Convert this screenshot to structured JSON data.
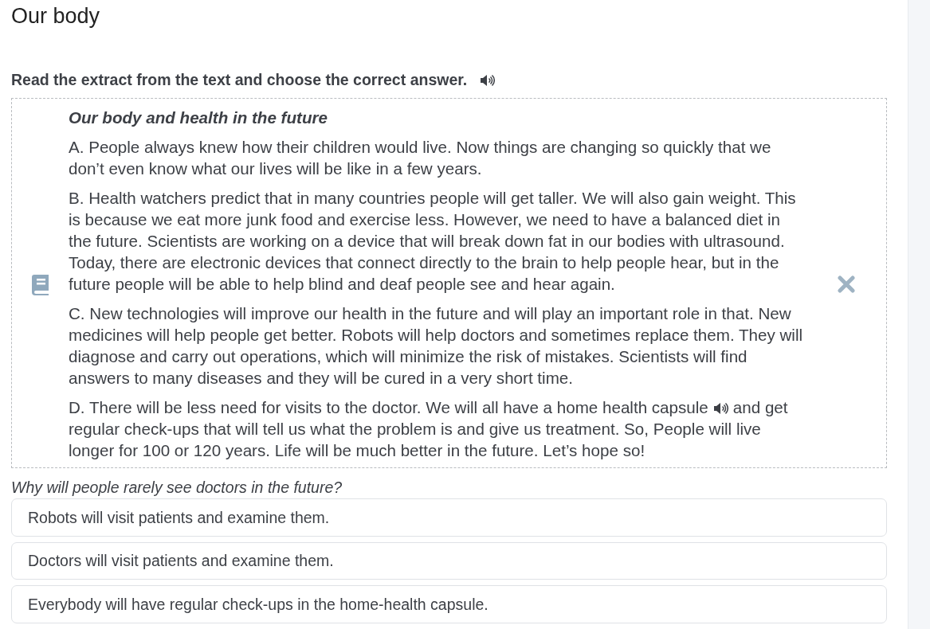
{
  "page_title": "Our body",
  "instruction": {
    "text": "Read the extract from the text and choose the correct answer.",
    "audio": true
  },
  "passage": {
    "title": "Our body and health in the future",
    "paragraphs": [
      {
        "segments": [
          {
            "kind": "text",
            "text": "A. People always knew how their children would live. Now things are changing so quickly that we don’t even know what our lives will be like in a few years."
          }
        ]
      },
      {
        "segments": [
          {
            "kind": "text",
            "text": "B. Health watchers predict that in many countries people will get taller. We will also gain weight. This is because we eat more junk food and exercise less. However, we need to have a balanced diet in the future. Scientists are working on a device that will break down fat in our bodies with ultrasound. Today, there are electronic devices that connect directly to the brain to help people hear, but in the future people will be able to help blind and deaf people see and hear again."
          }
        ]
      },
      {
        "segments": [
          {
            "kind": "text",
            "text": "C. New technologies will improve our health in the future and will play an important role in that. New medicines will help people get better. Robots will help doctors and sometimes replace them. They will diagnose and carry out operations, which will minimize the risk of mistakes. Scientists will find answers to many diseases and they will be cured in a very short time."
          }
        ]
      },
      {
        "segments": [
          {
            "kind": "text",
            "text": "D. There will be less need for visits to the doctor. We will all have a home health capsule"
          },
          {
            "kind": "audio"
          },
          {
            "kind": "text",
            "text": "and get"
          },
          {
            "kind": "break"
          },
          {
            "kind": "text",
            "text": "regular check-ups that will tell us what the problem is and give us treatment. So, People will live longer for 100 or 120 years. Life will be much better in the future. Let’s hope so!"
          }
        ]
      }
    ]
  },
  "question": "Why will people rarely see doctors in the future?",
  "options": [
    {
      "text": "Robots will visit patients and examine them.",
      "selected": false
    },
    {
      "text": "Doctors will visit patients and examine them.",
      "selected": false
    },
    {
      "text": "Everybody will have regular check-ups in the home-health capsule.",
      "selected": false
    }
  ]
}
